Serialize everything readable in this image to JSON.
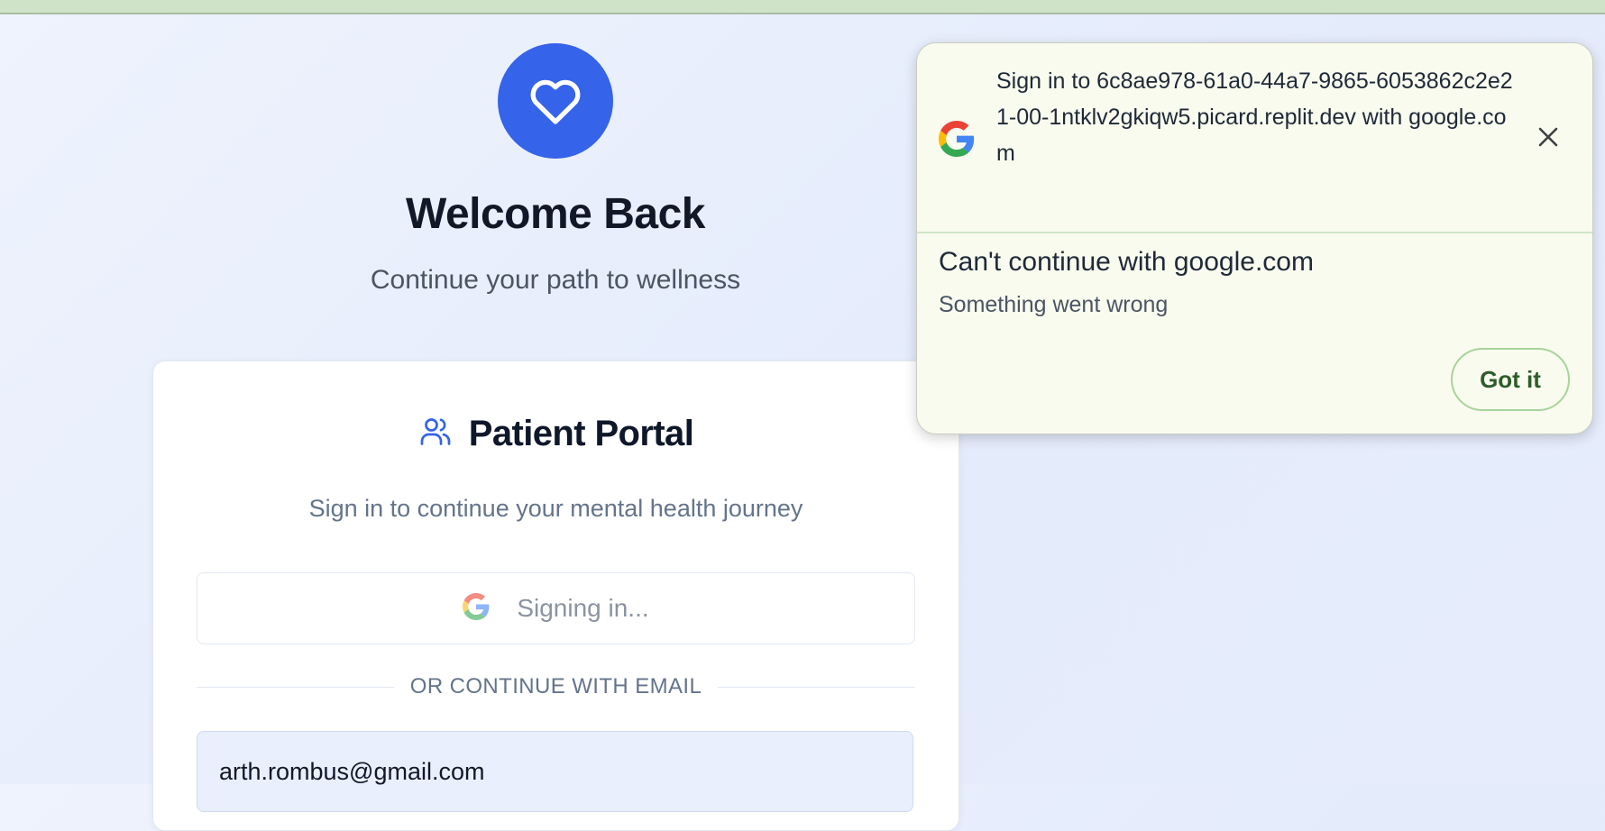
{
  "page": {
    "welcome_title": "Welcome Back",
    "subtitle": "Continue your path to wellness"
  },
  "card": {
    "title": "Patient Portal",
    "subtitle": "Sign in to continue your mental health journey",
    "google_button_label": "Signing in...",
    "divider_text": "OR CONTINUE WITH EMAIL",
    "email_value": "arth.rombus@gmail.com"
  },
  "popup": {
    "header_text": "Sign in to 6c8ae978-61a0-44a7-9865-6053862c2e21-00-1ntklv2gkiqw5.picard.replit.dev with google.com",
    "error_title": "Can't continue with google.com",
    "error_subtitle": "Something went wrong",
    "button_label": "Got it"
  },
  "icons": {
    "logo": "heart-icon",
    "portal": "users-icon",
    "google": "google-icon",
    "close": "close-icon"
  },
  "colors": {
    "brand": "#3563e9",
    "popup_bg": "#f9fbef",
    "popup_button_text": "#2d5d2a"
  }
}
